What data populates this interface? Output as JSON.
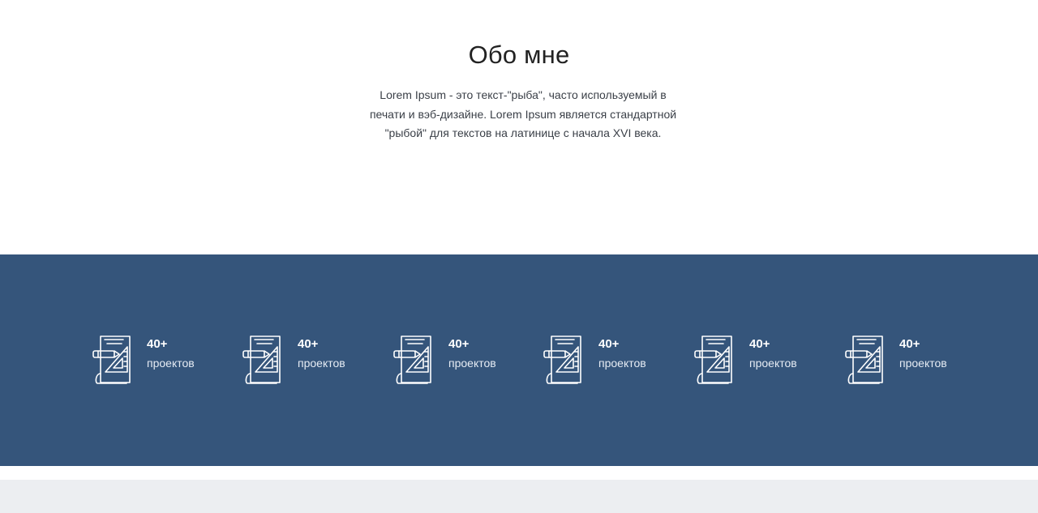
{
  "about": {
    "title": "Обо мне",
    "text": "Lorem Ipsum - это текст-\"рыба\", часто используемый в печати и вэб-дизайне. Lorem Ipsum является стандартной \"рыбой\" для текстов на латинице с начала XVI века."
  },
  "stats": {
    "background_color": "#35557b",
    "icon": "blueprint-drafting-icon",
    "items": [
      {
        "number": "40+",
        "label": "проектов"
      },
      {
        "number": "40+",
        "label": "проектов"
      },
      {
        "number": "40+",
        "label": "проектов"
      },
      {
        "number": "40+",
        "label": "проектов"
      },
      {
        "number": "40+",
        "label": "проектов"
      },
      {
        "number": "40+",
        "label": "проектов"
      }
    ]
  }
}
